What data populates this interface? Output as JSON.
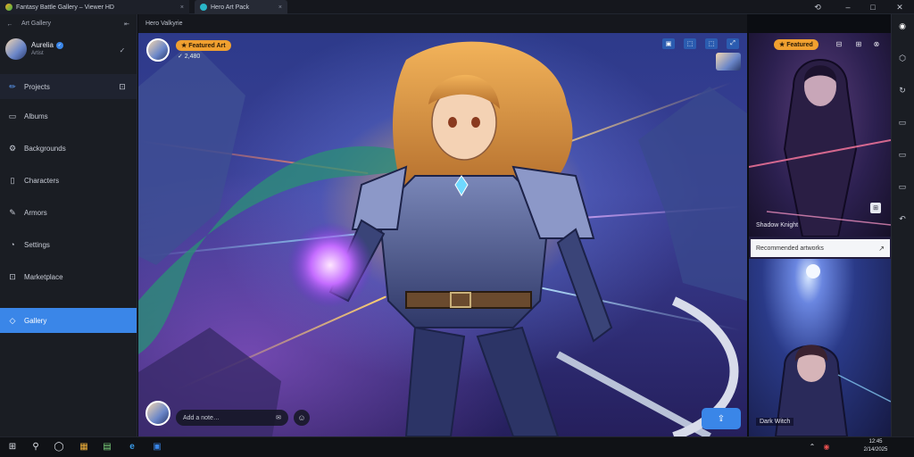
{
  "window": {
    "tabs": [
      {
        "label": "Fantasy Battle Gallery – Viewer HD",
        "close": "×"
      },
      {
        "label": "Hero Art Pack",
        "close": "×"
      }
    ],
    "controls": {
      "history": "⟲",
      "minimize": "–",
      "maximize": "□",
      "close": "✕"
    }
  },
  "sidebar": {
    "top": {
      "back": "←",
      "title": "Art Gallery",
      "collapse": "⇤"
    },
    "user": {
      "name": "Aurelia",
      "handle": "Artist",
      "verified": "✓",
      "action": "✓"
    },
    "nav": [
      {
        "icon": "✏",
        "label": "Projects",
        "action": "⊡"
      },
      {
        "icon": "▭",
        "label": "Albums"
      },
      {
        "icon": "⚙",
        "label": "Backgrounds"
      },
      {
        "icon": "▯",
        "label": "Characters"
      },
      {
        "icon": "✎",
        "label": "Armors"
      },
      {
        "icon": "◔",
        "label": "Settings"
      },
      {
        "icon": "⊡",
        "label": "Marketplace"
      },
      {
        "icon": "◇",
        "label": "Gallery"
      }
    ]
  },
  "viewer": {
    "bar_title": "Hero Valkyrie",
    "author": {
      "badge": "★ Featured Art",
      "stats": "✓ 2,480"
    },
    "tools": [
      "▣",
      "⬚",
      "⬚",
      "⤢"
    ],
    "comment": {
      "placeholder": "Add a note…",
      "send": "✉",
      "emoji": "☺"
    },
    "share_label": "⇪"
  },
  "right_panel": {
    "badge": "★ Featured",
    "tools": [
      "⊟",
      "⊞",
      "⊗"
    ],
    "caption1": "Shadow Knight",
    "search_text": "Recommended artworks",
    "search_arrow": "↗",
    "caption2": "Dark Witch",
    "more": "⊞"
  },
  "rail": [
    "◉",
    "⬡",
    "↻",
    "▭",
    "▭",
    "▭",
    "↶"
  ],
  "taskbar": {
    "start": "⊞",
    "search": "⚲",
    "cortana": "◯",
    "apps": [
      "▦",
      "▤",
      "e",
      "▣"
    ],
    "tray": {
      "up": "⌃",
      "status": "◉",
      "time": "12:45",
      "date": "2/14/2025"
    }
  },
  "colors": {
    "accent": "#3a86e8",
    "badge": "#f0a030",
    "sidebar_bg": "#1a1d23"
  }
}
